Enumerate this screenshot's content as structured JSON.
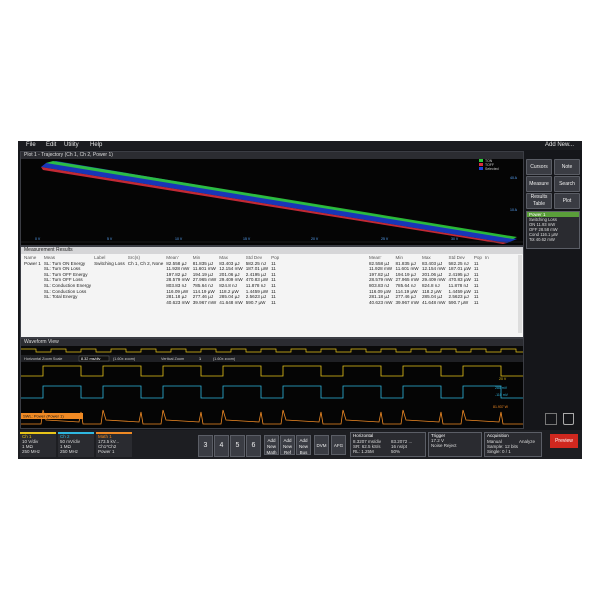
{
  "menu": [
    "File",
    "Edit",
    "Utility",
    "Help"
  ],
  "add_new": "Add New...",
  "plot": {
    "title": "Plot 1 - Trajectory (Ch 1, Ch 2, Power 1)",
    "legend": [
      "TON",
      "TOFF",
      "Selected"
    ],
    "xticks": [
      "0 V",
      "5 V",
      "10 V",
      "15 V",
      "20 V",
      "25 V",
      "30 V"
    ],
    "ylabels": [
      "40 A",
      "10 A"
    ]
  },
  "measurements": {
    "title": "Measurement Results",
    "headers": [
      "Name",
      "Meas",
      "Label",
      "Src(s)",
      "Mean'",
      "Min",
      "Max",
      "Std Dev",
      "Pop"
    ],
    "source_name": "Power 1",
    "label": "Switching Loss",
    "sources": "Ch 1, Ch 2, None",
    "meas_names": [
      "SL: Turn ON Energy",
      "SL: Turn ON Loss",
      "SL: Turn OFF Energy",
      "SL: Turn OFF Loss",
      "SL: Conduction Energy",
      "SL: Conduction Loss",
      "SL: Total Energy"
    ],
    "rows": [
      [
        "82.558 µJ",
        "81.835 µJ",
        "83.403 µJ",
        "582.25 nJ",
        "11"
      ],
      [
        "11.928 mW",
        "11.601 mW",
        "12.154 mW",
        "187.01 µW",
        "11"
      ],
      [
        "197.82 µJ",
        "194.19 µJ",
        "201.06 µJ",
        "2.4195 µJ",
        "11"
      ],
      [
        "28.579 mW",
        "27.965 mW",
        "29.409 mW",
        "470.83 µW",
        "11"
      ],
      [
        "803.83 nJ",
        "785.64 nJ",
        "824.8 nJ",
        "11.878 nJ",
        "11"
      ],
      [
        "116.09 µW",
        "114.19 µW",
        "118.2 µW",
        "1.4459 µW",
        "11"
      ],
      [
        "281.18 µJ",
        "277.46 µJ",
        "285.04 µJ",
        "2.5623 µJ",
        "11"
      ],
      [
        "40.623 mW",
        "39.967 mW",
        "41.648 mW",
        "590.7 µW",
        "11"
      ]
    ],
    "last_col_label": "In"
  },
  "waveform": {
    "title": "Waveform View",
    "zoom_label": "Horizontal Zoom Scale",
    "zoom_value": "8.32 ms/div",
    "zoom_factor_1": "(1.60x zoom)",
    "vert_label": "Vertical Zoom",
    "vert_value": "1",
    "zoom_factor_2": "(1.60x zoom)",
    "power_label": "SWL: Power (Power 1)",
    "scale_right": [
      "20 V",
      "280 mV",
      "-110 mV",
      "81.937 W"
    ]
  },
  "sidebar": {
    "buttons": [
      "Cursors",
      "Note",
      "Measure",
      "Search",
      "Results Table",
      "Plot"
    ],
    "power_title": "Power 1",
    "power_sub": "Switching Loss",
    "power_rows": [
      "11.93 mW",
      "28.58 mW",
      "116.1 µW",
      "40.62 mW"
    ],
    "power_keys": [
      "ON",
      "OFF",
      "Cond",
      "Tot"
    ]
  },
  "bottom": {
    "ch1": {
      "title": "Ch 1",
      "lines": [
        "10 V/div",
        "1 MΩ",
        "250 MHz"
      ]
    },
    "ch2": {
      "title": "Ch 2",
      "lines": [
        "50 mV/div",
        "1 MΩ",
        "250 MHz"
      ]
    },
    "math": {
      "title": "Math 1",
      "lines": [
        "173.5 kV...",
        "Ch1*Ch2",
        "Power 1"
      ]
    },
    "numbers": [
      "3",
      "4",
      "5",
      "6"
    ],
    "adds": [
      [
        "Add",
        "New",
        "Math"
      ],
      [
        "Add",
        "New",
        "Ref"
      ],
      [
        "Add",
        "New",
        "Bus"
      ]
    ],
    "dvm": "DVM",
    "afg": "AFG",
    "horizontal": {
      "title": "Horizontal",
      "lines": [
        "8.3207 ms/div",
        "SR: 62.5 kS/s",
        "RL: 1.25M"
      ],
      "lines2": [
        "83.2072 ...",
        "16 ns/pt",
        "50%"
      ]
    },
    "trigger": {
      "title": "Trigger",
      "lines": [
        "17.2 V",
        "Noise Reject"
      ]
    },
    "acq": {
      "title": "Acquisition",
      "lines": [
        "Manual",
        "Sample: 12 bits",
        "Single: 0 / 1"
      ],
      "extra": "Analyze"
    },
    "preview": "Preview"
  },
  "colors": {
    "ch1": "#e8c51a",
    "ch2": "#2fb7e0",
    "math": "#f08a24",
    "accent": "#d0281f"
  }
}
